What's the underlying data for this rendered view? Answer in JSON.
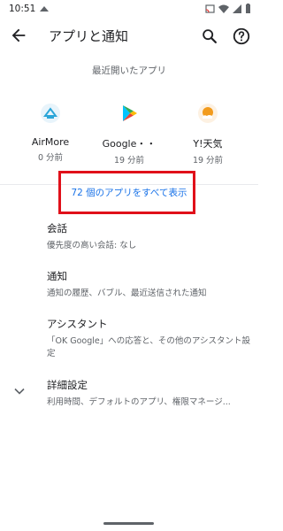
{
  "status_bar": {
    "time": "10:51"
  },
  "toolbar": {
    "title": "アプリと通知"
  },
  "recent": {
    "header": "最近開いたアプリ",
    "apps": [
      {
        "name": "AirMore",
        "time": "0 分前",
        "icon": "airmore-icon",
        "color": "#2aa5d8"
      },
      {
        "name": "Google・・",
        "time": "19 分前",
        "icon": "google-play-icon",
        "color": "#34a853"
      },
      {
        "name": "Y!天気",
        "time": "19 分前",
        "icon": "yahoo-weather-icon",
        "color": "#f29b1d"
      }
    ],
    "see_all": "72 個のアプリをすべて表示"
  },
  "settings": [
    {
      "title": "会話",
      "subtitle": "優先度の高い会話: なし"
    },
    {
      "title": "通知",
      "subtitle": "通知の履歴、バブル、最近送信された通知"
    },
    {
      "title": "アシスタント",
      "subtitle": "「OK Google」への応答と、その他のアシスタント設定"
    },
    {
      "title": "詳細設定",
      "subtitle": "利用時間、デフォルトのアプリ、権限マネージ..."
    }
  ],
  "colors": {
    "accent": "#1a73e8",
    "highlight": "#e0101a"
  }
}
